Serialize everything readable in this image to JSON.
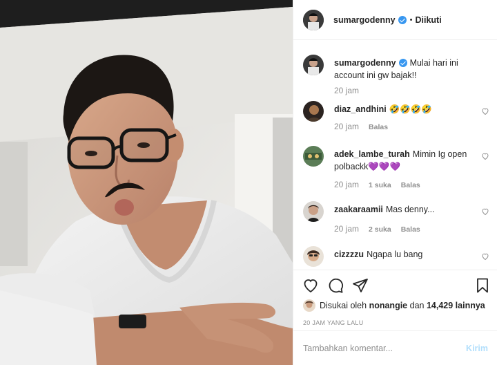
{
  "header": {
    "username": "sumargodenny",
    "dot": "•",
    "follow_label": "Diikuti"
  },
  "caption": {
    "username": "sumargodenny",
    "text": "Mulai hari ini account ini gw bajak!!",
    "time": "20 jam"
  },
  "comments": [
    {
      "username": "diaz_andhini",
      "text": "🤣🤣🤣🤣",
      "time": "20 jam",
      "likes": "",
      "reply": "Balas"
    },
    {
      "username": "adek_lambe_turah",
      "text": "Mimin Ig open polbackk💜💜💜",
      "time": "20 jam",
      "likes": "1 suka",
      "reply": "Balas"
    },
    {
      "username": "zaakaraamii",
      "text": "Mas denny...",
      "time": "20 jam",
      "likes": "2 suka",
      "reply": "Balas"
    },
    {
      "username": "cizzzzu",
      "text": "Ngapa lu bang",
      "time": "",
      "likes": "",
      "reply": ""
    }
  ],
  "likes": {
    "prefix": "Disukai oleh",
    "user": "nonangie",
    "conj": "dan",
    "count": "14,429 lainnya"
  },
  "posted_ago": "20 JAM YANG LALU",
  "add_comment": {
    "placeholder": "Tambahkan komentar...",
    "send_label": "Kirim"
  },
  "icons": [
    "verified-badge-icon",
    "heart-icon",
    "comment-icon",
    "share-icon",
    "bookmark-icon"
  ],
  "colors": {
    "verified": "#3897f0",
    "muted": "#8e8e8e",
    "send_disabled": "#b2dffc"
  }
}
